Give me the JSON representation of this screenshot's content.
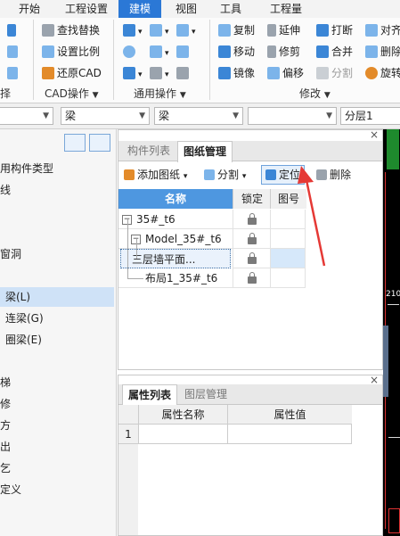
{
  "menu": {
    "tabs": [
      "开始",
      "工程设置",
      "建模",
      "视图",
      "工具",
      "工程量"
    ],
    "active": "建模"
  },
  "ribbon": {
    "cad_group": {
      "items": [
        "查找替换",
        "设置比例",
        "还原CAD"
      ],
      "label": "CAD操作"
    },
    "common_group": {
      "label": "通用操作"
    },
    "modify_group": {
      "items": [
        "复制",
        "延伸",
        "打断",
        "对齐",
        "移动",
        "修剪",
        "合并",
        "删除",
        "镜像",
        "偏移",
        "分割",
        "旋转"
      ],
      "label": "修改"
    },
    "left_partial_label": "择"
  },
  "selector": {
    "combo1": "",
    "combo2": "梁",
    "combo3": "梁",
    "combo4": "",
    "combo5": "分层1"
  },
  "left_nav": {
    "items": [
      "用构件类型",
      "线",
      "窗洞",
      "梁(L)",
      "连梁(G)",
      "圈梁(E)",
      "梯",
      "修",
      "方",
      "出",
      "乞",
      "定义"
    ],
    "selected": "梁(L)"
  },
  "drawing_panel": {
    "tabs": [
      "构件列表",
      "图纸管理"
    ],
    "active_tab": "图纸管理",
    "toolbar": {
      "add": "添加图纸",
      "split": "分割",
      "locate": "定位",
      "delete": "删除"
    },
    "columns": [
      "名称",
      "锁定",
      "图号"
    ],
    "rows": [
      {
        "name": "35#_t6",
        "expander": "−"
      },
      {
        "name": "Model_35#_t6",
        "expander": "−"
      },
      {
        "name": "三层墙平面...",
        "expander": ""
      },
      {
        "name": "布局1_35#_t6",
        "expander": ""
      }
    ]
  },
  "property_panel": {
    "tabs": [
      "属性列表",
      "图层管理"
    ],
    "active_tab": "属性列表",
    "columns": [
      "属性名称",
      "属性值"
    ],
    "row_number": "1"
  },
  "right_strip": {
    "label": "210"
  },
  "close_glyph": "×",
  "colors": {
    "accent": "#2b78d6",
    "header_blue": "#4e97e0",
    "arrow_red": "#e53935"
  }
}
